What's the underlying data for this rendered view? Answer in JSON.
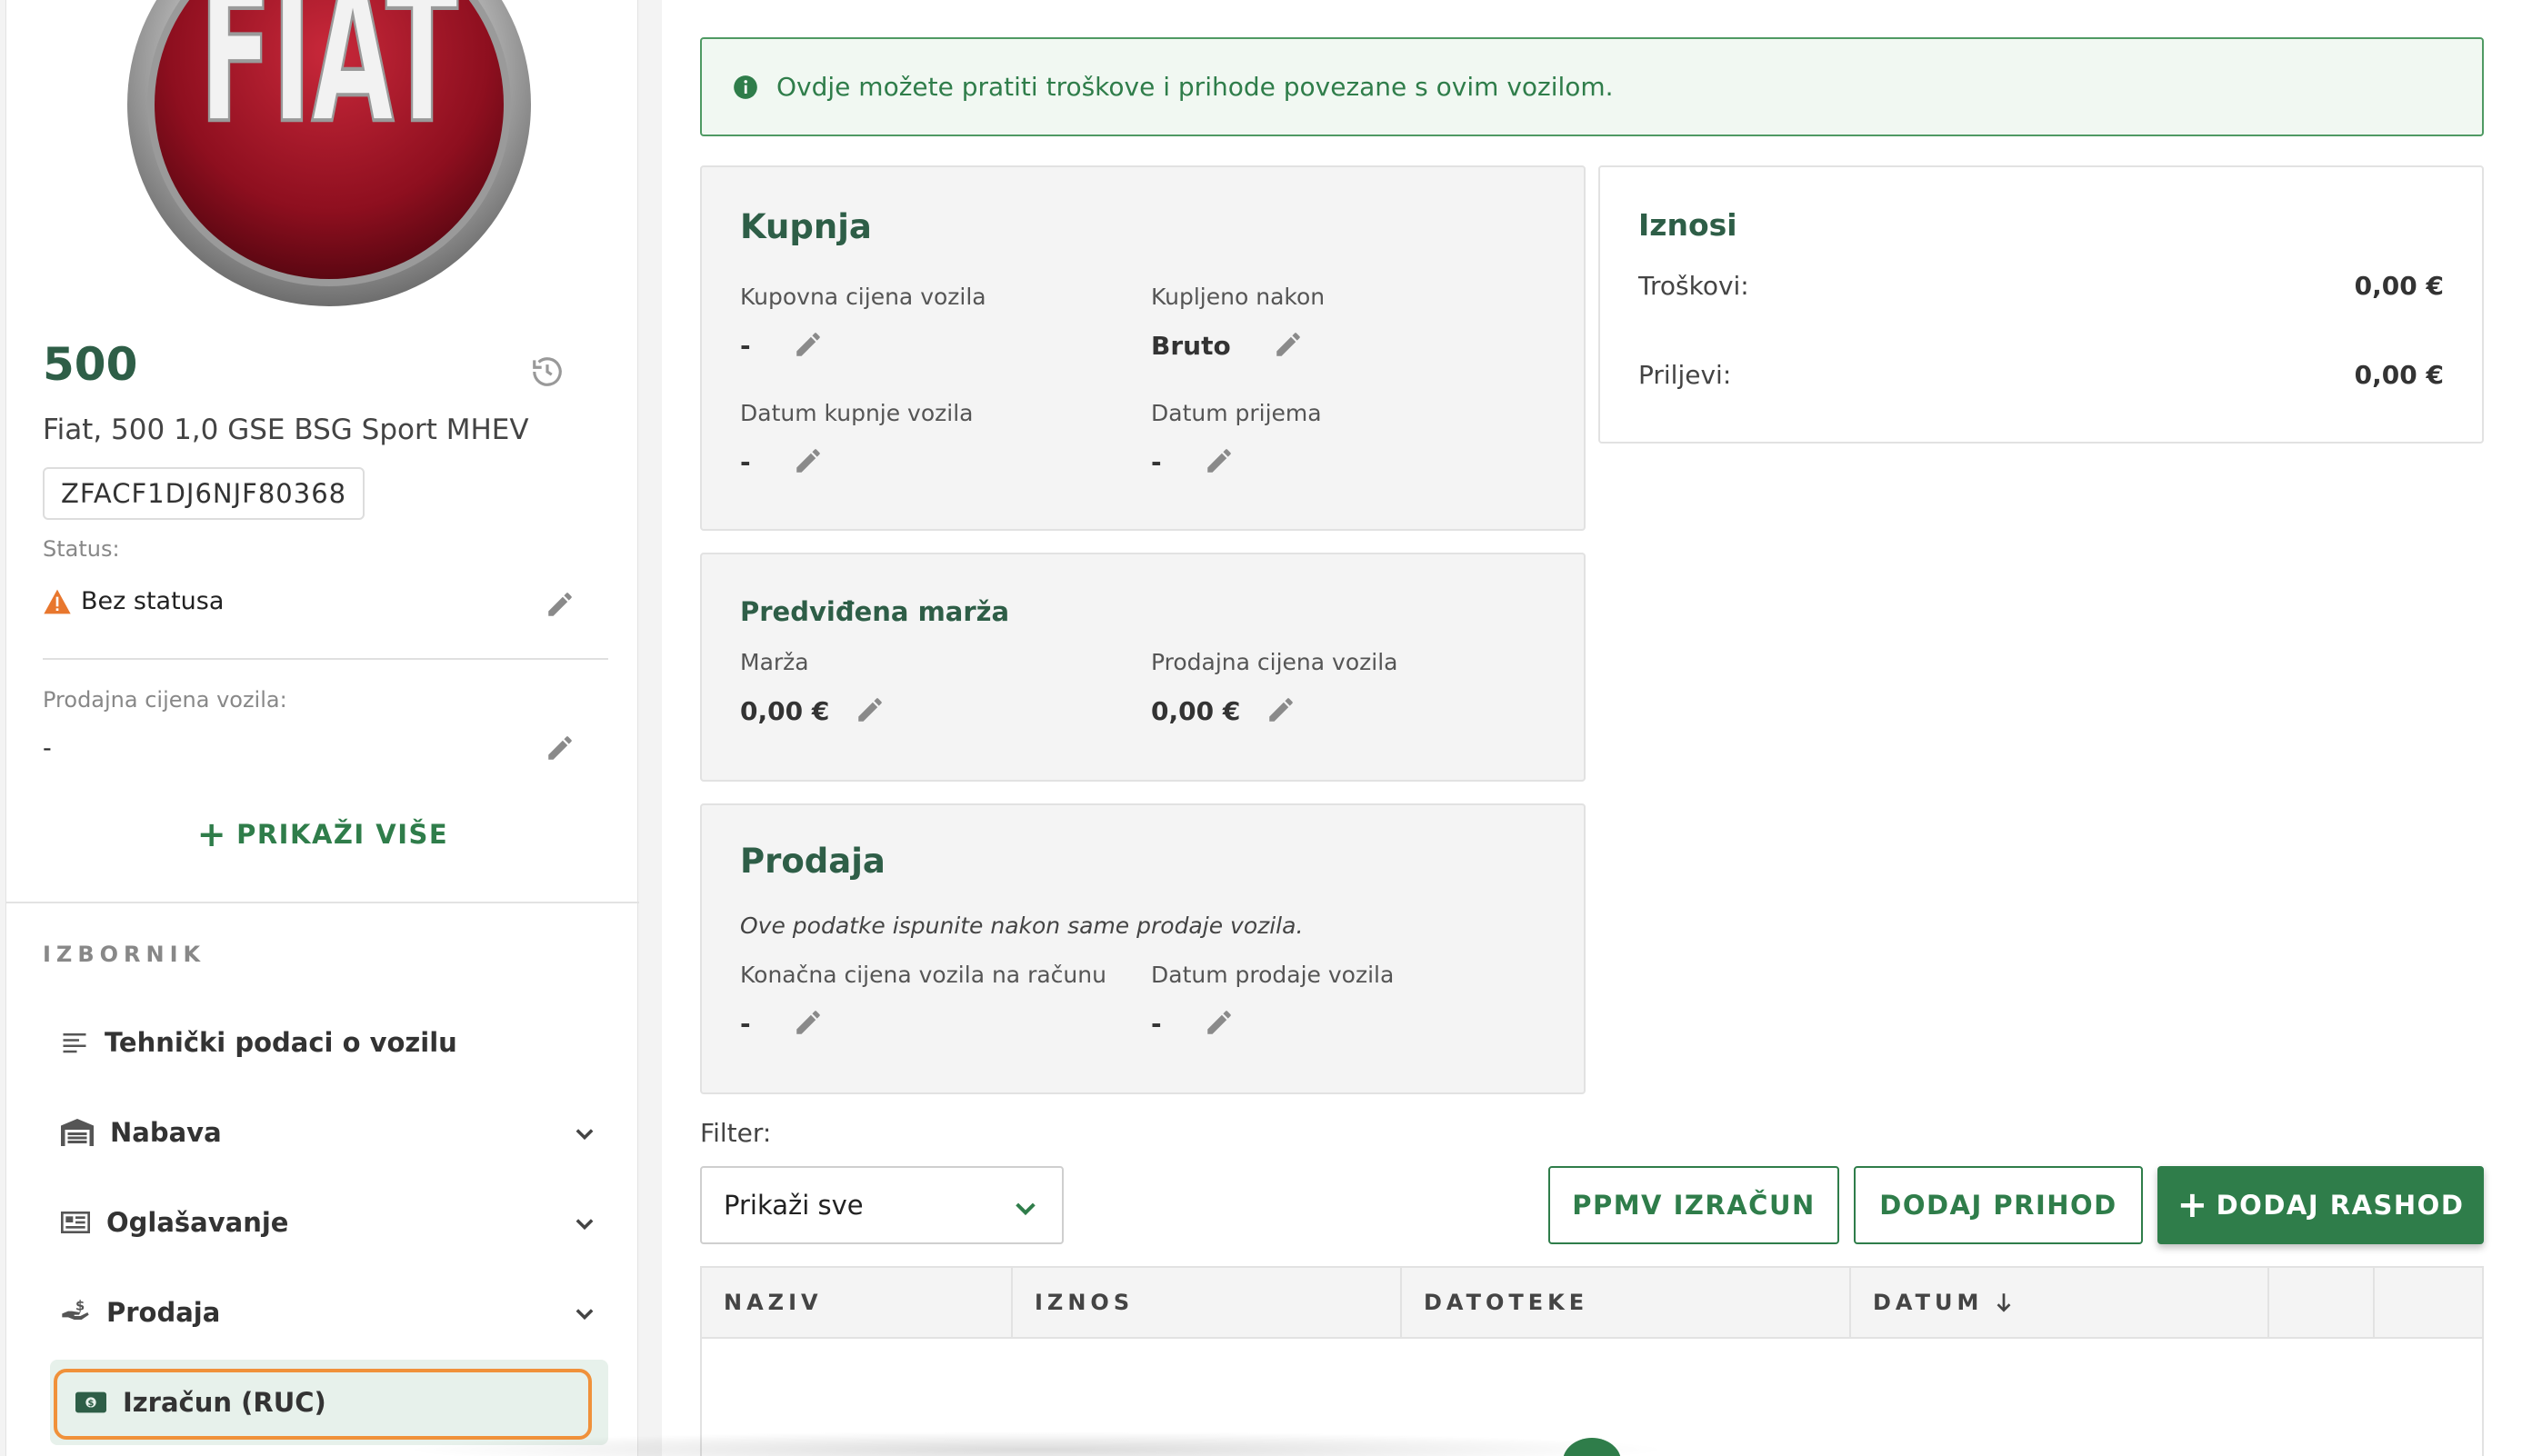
{
  "vehicle": {
    "brand_logo_text": "FIAT",
    "model": "500",
    "full_name": "Fiat, 500 1,0 GSE BSG Sport MHEV",
    "vin": "ZFACF1DJ6NJF80368",
    "status_label": "Status:",
    "status_value": "Bez statusa",
    "sale_price_label": "Prodajna cijena vozila:",
    "sale_price_value": "-",
    "show_more": "PRIKAŽI VIŠE"
  },
  "menu": {
    "title": "IZBORNIK",
    "items": [
      {
        "label": "Tehnički podaci o vozilu",
        "icon": "list-icon",
        "expandable": false
      },
      {
        "label": "Nabava",
        "icon": "garage-icon",
        "expandable": true
      },
      {
        "label": "Oglašavanje",
        "icon": "newspaper-icon",
        "expandable": true
      },
      {
        "label": "Prodaja",
        "icon": "hand-money-icon",
        "expandable": true
      },
      {
        "label": "Izračun (RUC)",
        "icon": "cash-icon",
        "expandable": false,
        "active": true
      }
    ]
  },
  "banner": {
    "text": "Ovdje možete pratiti troškove i prihode povezane s ovim vozilom."
  },
  "purchase": {
    "title": "Kupnja",
    "price_label": "Kupovna cijena vozila",
    "price_value": "-",
    "bought_after_label": "Kupljeno nakon",
    "bought_after_value": "Bruto",
    "purchase_date_label": "Datum kupnje vozila",
    "purchase_date_value": "-",
    "receipt_date_label": "Datum prijema",
    "receipt_date_value": "-"
  },
  "margin": {
    "title": "Predviđena marža",
    "margin_label": "Marža",
    "margin_value": "0,00 €",
    "sale_price_label": "Prodajna cijena vozila",
    "sale_price_value": "0,00 €"
  },
  "sale": {
    "title": "Prodaja",
    "note": "Ove podatke ispunite nakon same prodaje vozila.",
    "final_price_label": "Konačna cijena vozila na računu",
    "final_price_value": "-",
    "sale_date_label": "Datum prodaje vozila",
    "sale_date_value": "-"
  },
  "amounts": {
    "title": "Iznosi",
    "costs_label": "Troškovi:",
    "costs_value": "0,00 €",
    "income_label": "Priljevi:",
    "income_value": "0,00 €"
  },
  "filter": {
    "label": "Filter:",
    "selected": "Prikaži sve"
  },
  "actions": {
    "ppmv": "PPMV IZRAČUN",
    "add_income": "DODAJ PRIHOD",
    "add_expense": "DODAJ RASHOD"
  },
  "table": {
    "columns": [
      "NAZIV",
      "IZNOS",
      "DATOTEKE",
      "DATUM"
    ]
  },
  "colors": {
    "brand_green": "#2f7d4a",
    "heading_green": "#2e5e47",
    "warning_orange": "#e8772e",
    "active_outline": "#f0913a"
  }
}
